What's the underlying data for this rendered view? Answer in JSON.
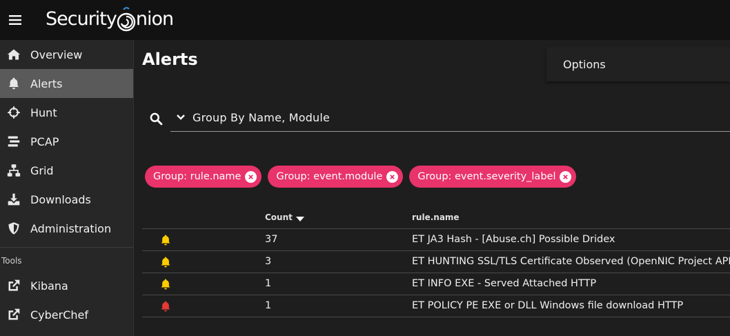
{
  "header": {
    "logo_text_before": "Security",
    "logo_text_after": "nion"
  },
  "sidebar": {
    "items": [
      {
        "label": "Overview",
        "icon": "home-icon"
      },
      {
        "label": "Alerts",
        "icon": "bell-icon",
        "active": true
      },
      {
        "label": "Hunt",
        "icon": "crosshairs-icon"
      },
      {
        "label": "PCAP",
        "icon": "stream-icon"
      },
      {
        "label": "Grid",
        "icon": "sitemap-icon"
      },
      {
        "label": "Downloads",
        "icon": "download-icon"
      },
      {
        "label": "Administration",
        "icon": "shield-icon"
      }
    ],
    "tools_label": "Tools",
    "tools": [
      {
        "label": "Kibana",
        "icon": "external-link-icon"
      },
      {
        "label": "CyberChef",
        "icon": "external-link-icon"
      }
    ]
  },
  "main": {
    "title": "Alerts",
    "options_label": "Options",
    "query_value": "Group By Name, Module",
    "chips": [
      "Group: rule.name",
      "Group: event.module",
      "Group: event.severity_label"
    ],
    "table": {
      "headers": {
        "count": "Count",
        "rule": "rule.name"
      },
      "rows": [
        {
          "severity": "medium",
          "count": "37",
          "rule": "ET JA3 Hash - [Abuse.ch] Possible Dridex"
        },
        {
          "severity": "medium",
          "count": "3",
          "rule": "ET HUNTING SSL/TLS Certificate Observed (OpenNIC Project API)"
        },
        {
          "severity": "medium",
          "count": "1",
          "rule": "ET INFO EXE - Served Attached HTTP"
        },
        {
          "severity": "high",
          "count": "1",
          "rule": "ET POLICY PE EXE or DLL Windows file download HTTP"
        }
      ]
    }
  },
  "colors": {
    "chip": "#e8336b",
    "bell_medium": "#ffcc00",
    "bell_high": "#e53935",
    "logo_accent": "#3b8fd6"
  }
}
